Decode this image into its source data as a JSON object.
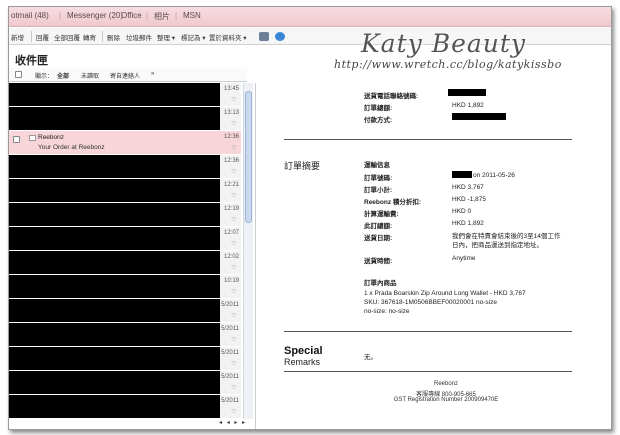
{
  "topnav": {
    "items": [
      "otmail (48)",
      "Messenger (20)",
      "Office",
      "相片",
      "MSN"
    ]
  },
  "toolbar": {
    "items": [
      "新增",
      "回覆",
      "全部回覆",
      "轉寄",
      "刪除",
      "垃圾郵件",
      "整理 ▾",
      "標記為 ▾",
      "置於資料夾 ▾"
    ]
  },
  "watermark": {
    "title": "Katy Beauty",
    "url": "http://www.wretch.cc/blog/katykissbo"
  },
  "folder": {
    "title": "收件匣",
    "filters": [
      "顯示：",
      "全部",
      "未讀取",
      "寄自連絡人",
      "»"
    ]
  },
  "messages": [
    {
      "time": "13:45"
    },
    {
      "time": "13:13"
    },
    {
      "time": "12:36",
      "sender": "Reebonz",
      "subject": "Your Order at Reebonz",
      "selected": true
    },
    {
      "time": "12:36"
    },
    {
      "time": "12:21"
    },
    {
      "time": "12:19"
    },
    {
      "time": "12:07"
    },
    {
      "time": "12:02"
    },
    {
      "time": "10:19"
    },
    {
      "time": "5/2011"
    },
    {
      "time": "5/2011"
    },
    {
      "time": "5/2011"
    },
    {
      "time": "5/2011"
    },
    {
      "time": "5/2011"
    }
  ],
  "email": {
    "top_rows": [
      {
        "label": "送貨電話聯絡號碼:",
        "value": ""
      },
      {
        "label": "訂單總額:",
        "value": "HKD 1,892"
      },
      {
        "label": "付款方式:",
        "value": ""
      }
    ],
    "summary_title": "訂單摘要",
    "shipping_title": "運輸信息",
    "rows": [
      {
        "label": "訂單號碼:",
        "value": "on 2011-05-26"
      },
      {
        "label": "訂單小計:",
        "value": "HKD 3,767"
      },
      {
        "label": "Reebonz 積分折扣:",
        "value": "HKD -1,875"
      },
      {
        "label": "計算運輸費:",
        "value": "HKD 0"
      },
      {
        "label": "此訂總額:",
        "value": "HKD 1,892"
      },
      {
        "label": "送貨日期:",
        "value": "我們會在特賣會結束後的3至14個工作日內，把商品運送到指定地址。"
      },
      {
        "label": "送貨時間:",
        "value": "Anytime"
      }
    ],
    "items_title": "訂單內商品",
    "item_line1": "1 x Prada Boarskin Zip Around Long Wallet - HKD 3,767",
    "item_line2": "SKU: 367618-1M0506BBEF00020001 no-size",
    "item_line3": "no-size: no-size",
    "special": "Special",
    "remarks": "Remarks",
    "remarks_value": "无。",
    "footer_company": "Reebonz",
    "footer_hotline": "客服專線 800-905-665",
    "footer_gst": "GST Registration Number 200909470E"
  },
  "colors": {
    "nav_pink": "#efc9cf",
    "selected_row": "#f7d5d9",
    "cursor": "#f2c400"
  }
}
